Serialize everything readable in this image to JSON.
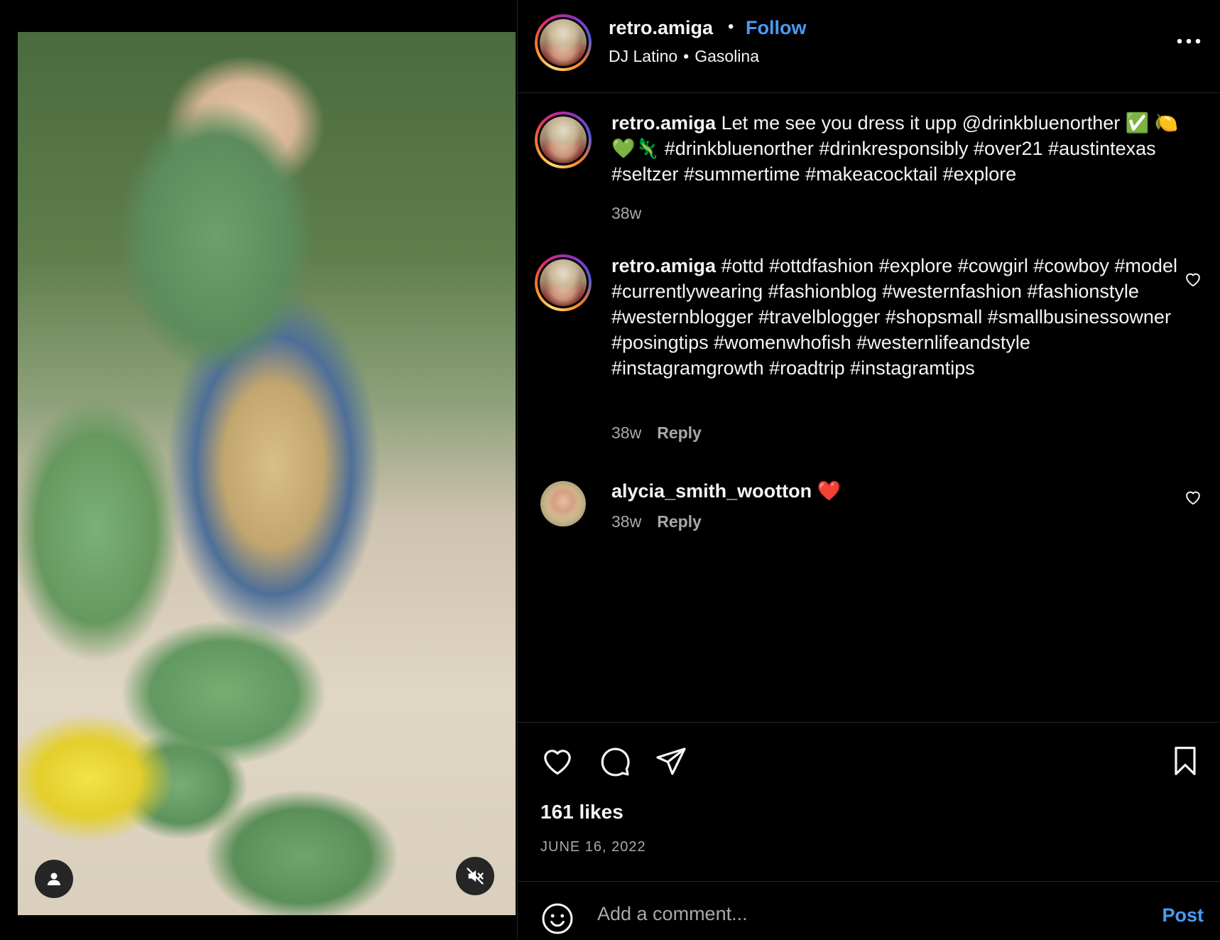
{
  "header": {
    "username": "retro.amiga",
    "separator": "•",
    "follow_label": "Follow",
    "audio_artist": "DJ Latino",
    "audio_separator": "•",
    "audio_track": "Gasolina",
    "more_icon": "more-horizontal-icon"
  },
  "comments": [
    {
      "username": "retro.amiga",
      "text": " Let me see you dress it upp @drinkbluenorther ✅ 🍋💚🦎 #drinkbluenorther #drinkresponsibly #over21 #austintexas #seltzer #summertime #makeacocktail #explore",
      "time": "38w"
    },
    {
      "username": "retro.amiga",
      "text": " #ottd #ottdfashion #explore #cowgirl #cowboy #model #currentlywearing #fashionblog #westernfashion #fashionstyle #westernblogger #travelblogger #shopsmall #smallbusinessowner #posingtips #womenwhofish #westernlifeandstyle #instagramgrowth #roadtrip #instagramtips",
      "time": "38w",
      "reply_label": "Reply"
    },
    {
      "username": "alycia_smith_wootton",
      "text": " ❤️",
      "time": "38w",
      "reply_label": "Reply"
    }
  ],
  "actions": {
    "like_icon": "heart-icon",
    "comment_icon": "comment-icon",
    "share_icon": "send-icon",
    "save_icon": "bookmark-icon"
  },
  "likes": "161 likes",
  "date": "JUNE 16, 2022",
  "add_comment": {
    "placeholder": "Add a comment...",
    "post_label": "Post",
    "emoji_icon": "emoji-icon"
  },
  "media": {
    "tag_users_icon": "user-icon",
    "mute_icon": "volume-muted-icon"
  },
  "colors": {
    "background": "#000000",
    "accent": "#4a9bf5",
    "secondary_text": "#a8a8a8",
    "divider": "#262626"
  }
}
